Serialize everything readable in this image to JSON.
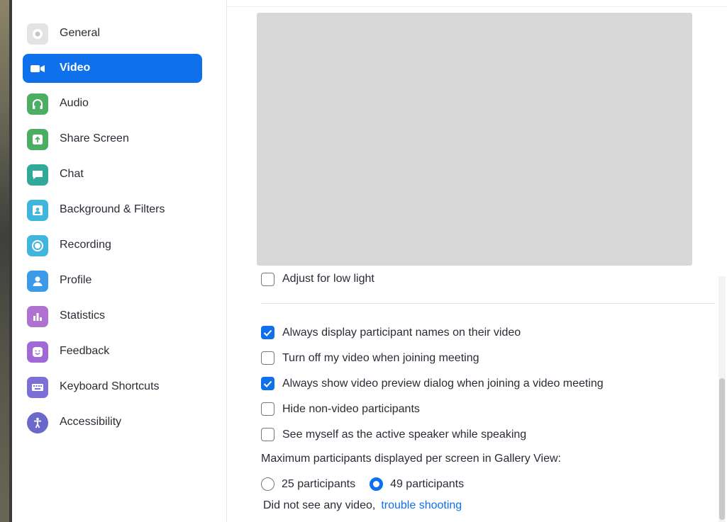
{
  "sidebar": {
    "items": [
      {
        "label": "General",
        "icon": "gear-icon",
        "color": "#e3e3e6",
        "active": false
      },
      {
        "label": "Video",
        "icon": "video-camera-icon",
        "color": "#0e71eb",
        "active": true
      },
      {
        "label": "Audio",
        "icon": "headphones-icon",
        "color": "#4cae63",
        "active": false
      },
      {
        "label": "Share Screen",
        "icon": "share-screen-icon",
        "color": "#4cae63",
        "active": false
      },
      {
        "label": "Chat",
        "icon": "chat-bubble-icon",
        "color": "#32a89a",
        "active": false
      },
      {
        "label": "Background & Filters",
        "icon": "background-portrait-icon",
        "color": "#40b6dd",
        "active": false
      },
      {
        "label": "Recording",
        "icon": "record-icon",
        "color": "#40b6dd",
        "active": false
      },
      {
        "label": "Profile",
        "icon": "person-icon",
        "color": "#3c9ae8",
        "active": false
      },
      {
        "label": "Statistics",
        "icon": "bar-chart-icon",
        "color": "#b072d0",
        "active": false
      },
      {
        "label": "Feedback",
        "icon": "smiley-icon",
        "color": "#a169d6",
        "active": false
      },
      {
        "label": "Keyboard Shortcuts",
        "icon": "keyboard-icon",
        "color": "#7c70d6",
        "active": false
      },
      {
        "label": "Accessibility",
        "icon": "accessibility-icon",
        "color": "#6a68c9",
        "active": false
      }
    ]
  },
  "video": {
    "low_light_label": "Adjust for low light",
    "options": [
      {
        "label": "Always display participant names on their video",
        "checked": true
      },
      {
        "label": "Turn off my video when joining meeting",
        "checked": false
      },
      {
        "label": "Always show video preview dialog when joining a video meeting",
        "checked": true
      },
      {
        "label": "Hide non-video participants",
        "checked": false
      },
      {
        "label": "See myself as the active speaker while speaking",
        "checked": false
      }
    ],
    "gallery_heading": "Maximum participants displayed per screen in Gallery View:",
    "gallery_options": [
      {
        "label": "25 participants",
        "selected": false
      },
      {
        "label": "49 participants",
        "selected": true
      }
    ],
    "help_text": "Did not see any video,",
    "help_link": "trouble shooting"
  },
  "colors": {
    "accent": "#0e71eb",
    "preview_bg": "#d8d8d8"
  }
}
